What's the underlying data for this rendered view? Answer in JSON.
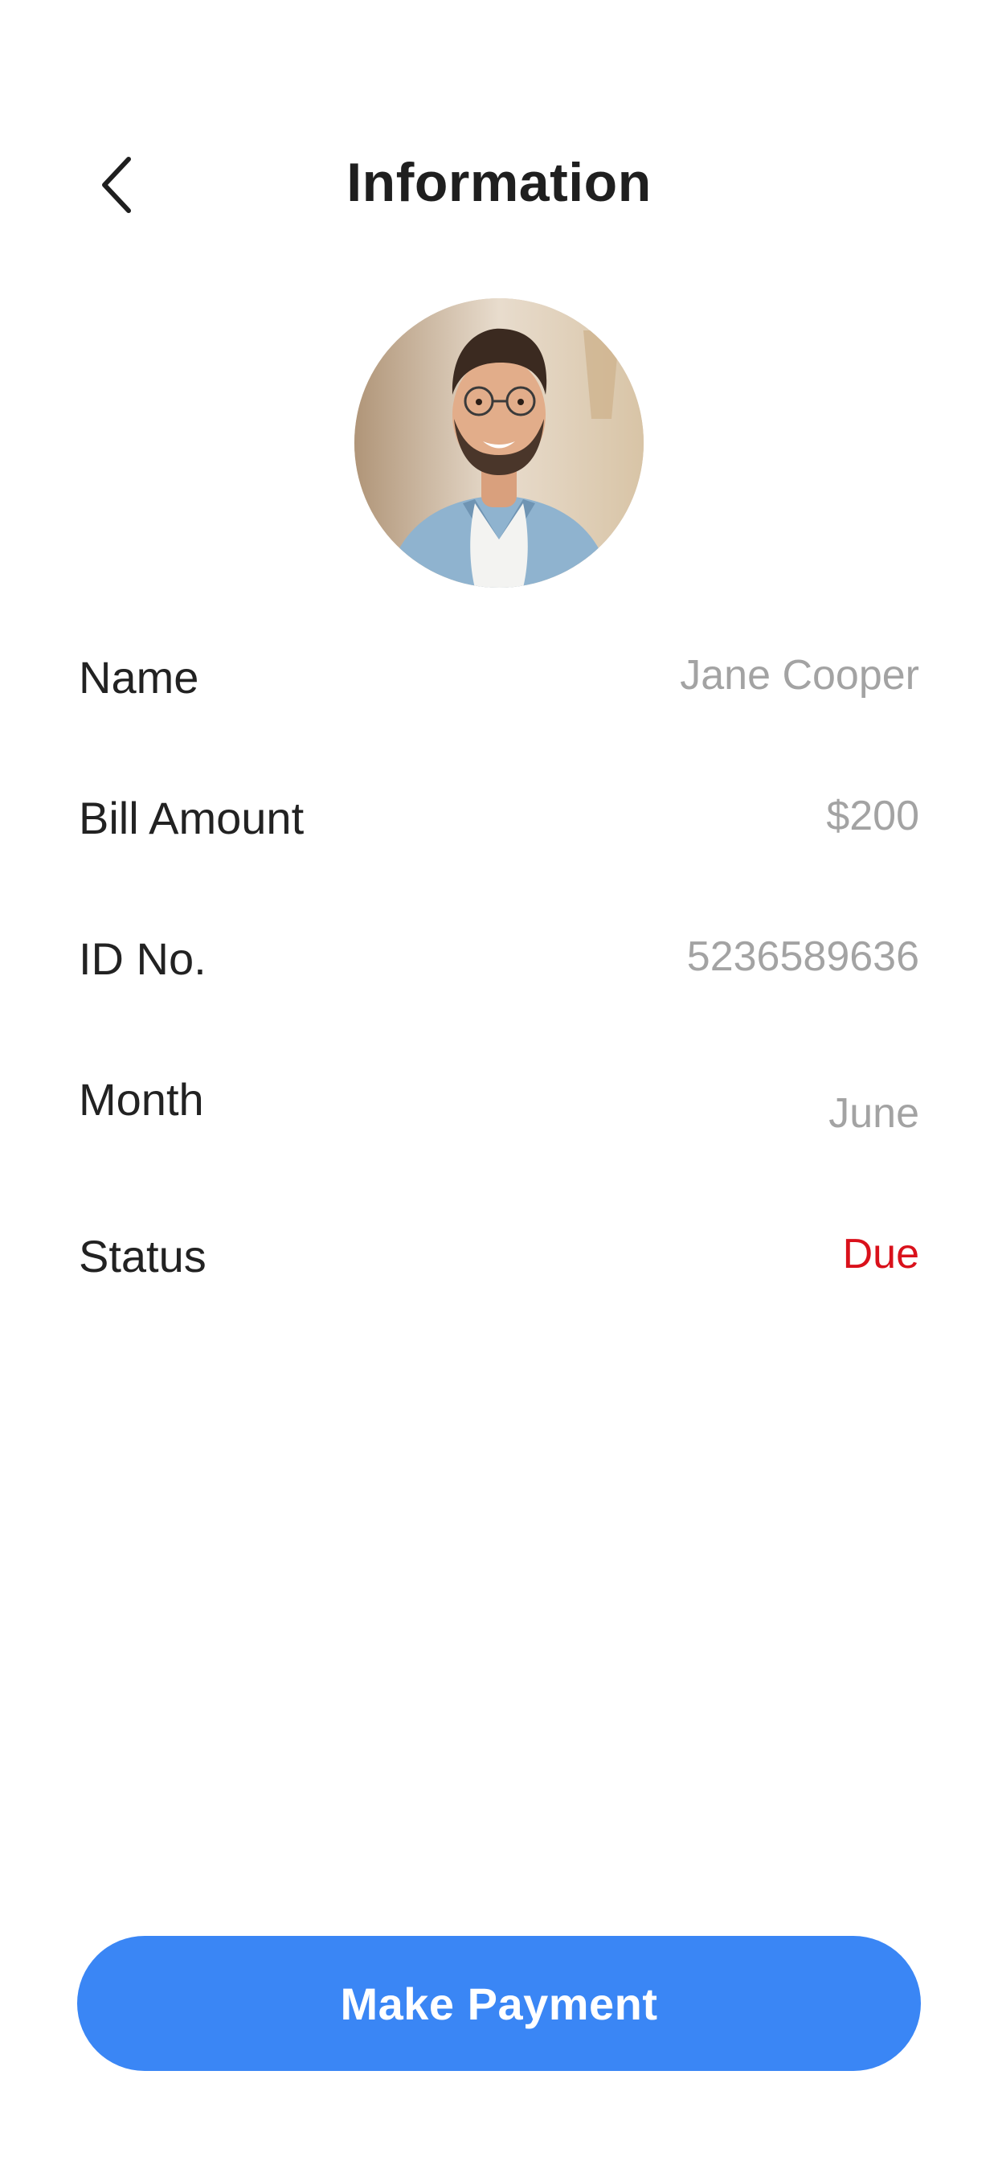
{
  "header": {
    "title": "Information",
    "back_icon": "chevron-left-icon"
  },
  "profile": {
    "avatar": "profile-photo"
  },
  "info": {
    "name": {
      "label": "Name",
      "value": "Jane Cooper"
    },
    "bill_amount": {
      "label": "Bill Amount",
      "value": "$200"
    },
    "id_no": {
      "label": "ID No.",
      "value": "5236589636"
    },
    "month": {
      "label": "Month",
      "value": "June"
    },
    "status": {
      "label": "Status",
      "value": "Due",
      "value_color": "#d9111b"
    }
  },
  "actions": {
    "pay_label": "Make Payment",
    "pay_color": "#3a86f5"
  }
}
